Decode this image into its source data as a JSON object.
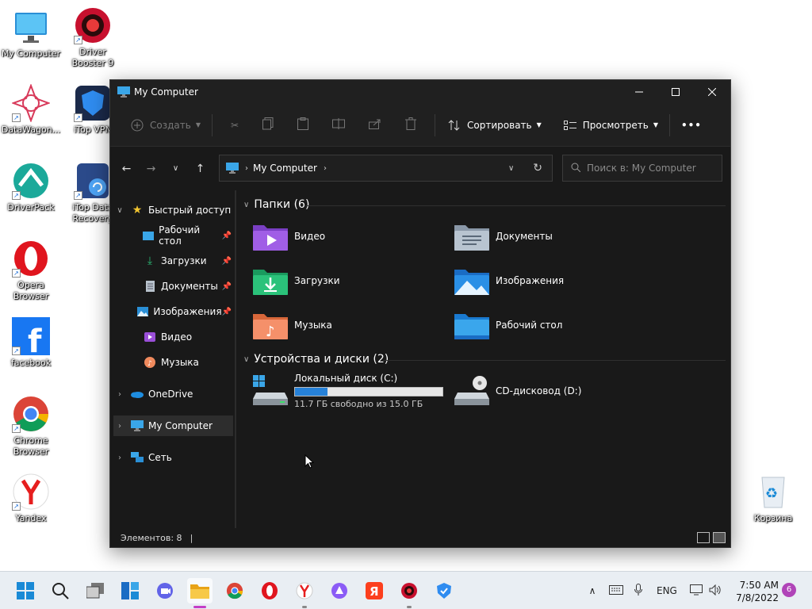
{
  "desktop": {
    "icons": [
      {
        "label": "My Computer"
      },
      {
        "label": "Driver Booster 9"
      },
      {
        "label": "DataWagon..."
      },
      {
        "label": "iTop VPN"
      },
      {
        "label": "DriverPack"
      },
      {
        "label": "iTop Data Recovery"
      },
      {
        "label": "Opera Browser"
      },
      {
        "label": "facebook"
      },
      {
        "label": "Chrome Browser"
      },
      {
        "label": "Yandex"
      },
      {
        "label": "Корзина"
      }
    ]
  },
  "window": {
    "title": "My Computer",
    "toolbar": {
      "create": "Создать",
      "sort": "Сортировать",
      "view": "Просмотреть",
      "more": "•••"
    },
    "address": {
      "crumb": "My Computer",
      "search_placeholder": "Поиск в: My Computer"
    },
    "sidebar": {
      "quick_access": "Быстрый доступ",
      "items": [
        {
          "label": "Рабочий стол"
        },
        {
          "label": "Загрузки"
        },
        {
          "label": "Документы"
        },
        {
          "label": "Изображения"
        },
        {
          "label": "Видео"
        },
        {
          "label": "Музыка"
        }
      ],
      "onedrive": "OneDrive",
      "my_computer": "My Computer",
      "network": "Сеть"
    },
    "folders_header": "Папки (6)",
    "folders": [
      {
        "name": "Видео"
      },
      {
        "name": "Документы"
      },
      {
        "name": "Загрузки"
      },
      {
        "name": "Изображения"
      },
      {
        "name": "Музыка"
      },
      {
        "name": "Рабочий стол"
      }
    ],
    "devices_header": "Устройства и диски (2)",
    "drives": [
      {
        "name": "Локальный диск (C:)",
        "free": "11.7 ГБ свободно из 15.0 ГБ",
        "used_fraction": 0.22
      },
      {
        "name": "CD-дисковод (D:)"
      }
    ],
    "status": "Элементов: 8"
  },
  "taskbar": {
    "lang": "ENG",
    "time": "7:50 AM",
    "date": "7/8/2022",
    "notifications": "6"
  },
  "colors": {
    "accent": "#2681d8",
    "window_bg": "#191919",
    "taskbar_bg": "#e9eef3"
  }
}
